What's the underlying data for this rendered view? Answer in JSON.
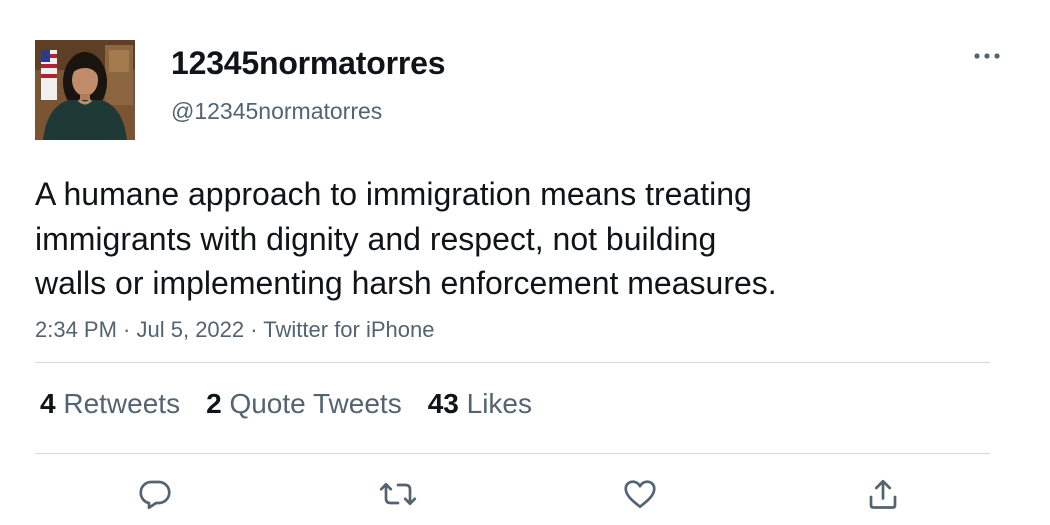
{
  "tweet": {
    "display_name": "12345normatorres",
    "handle": "@12345normatorres",
    "text": "A humane approach to immigration means treating immigrants with dignity and respect, not building walls or implementing harsh enforcement measures.",
    "text_lines": [
      "A humane approach to immigration means treating",
      "immigrants with dignity and respect, not building",
      "walls or implementing harsh enforcement measures."
    ],
    "time": "2:34 PM",
    "date": "Jul 5, 2022",
    "source": "Twitter for iPhone",
    "separator": " · "
  },
  "stats": {
    "retweets_count": "4",
    "retweets_label": "Retweets",
    "quotes_count": "2",
    "quotes_label": "Quote Tweets",
    "likes_count": "43",
    "likes_label": "Likes"
  },
  "icons": {
    "more": "more-horizontal-icon",
    "reply": "reply-icon",
    "retweet": "retweet-icon",
    "like": "heart-icon",
    "share": "share-icon"
  },
  "colors": {
    "primary_text": "#0f1419",
    "secondary_text": "#536471",
    "divider": "#cfd9de",
    "background": "#ffffff"
  }
}
